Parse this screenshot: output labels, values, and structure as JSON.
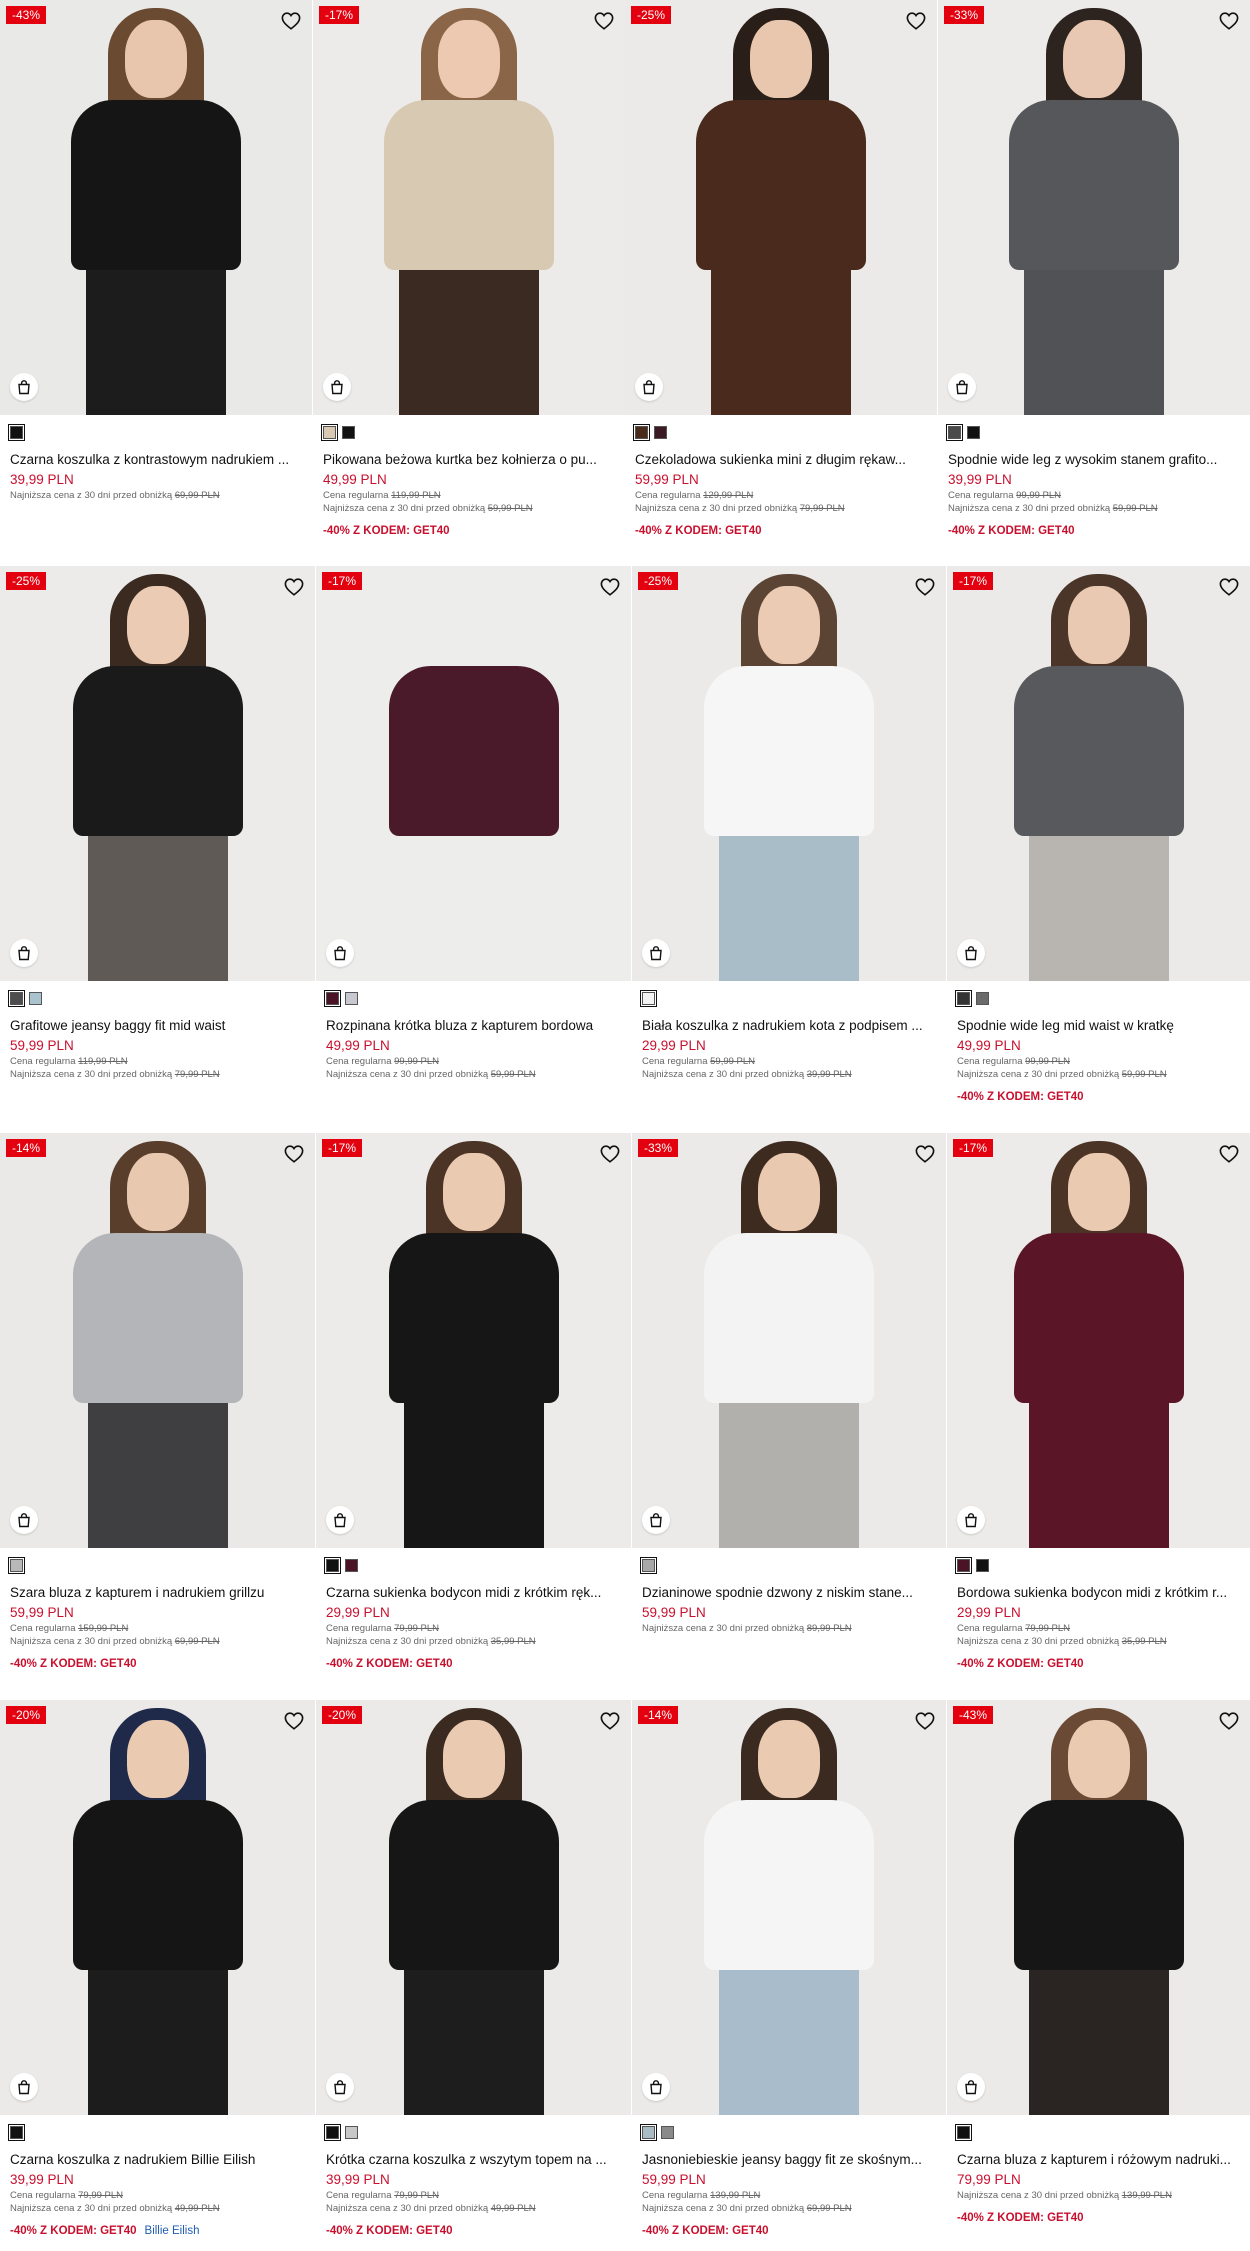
{
  "products": [
    {
      "name": "Czarna koszulka z kontrastowym nadrukiem ...",
      "price": "39,99 PLN",
      "discount": "-43%",
      "regular": "",
      "regular_price": "",
      "lowest": "Najniższa cena z 30 dni przed obniżką",
      "lowest_price": "69,99 PLN",
      "promo": "",
      "artist": "",
      "swatches": [
        "#111111"
      ],
      "look": {
        "bg": "#e9e9e7",
        "top": "#151515",
        "bottom": "#1c1c1c",
        "hair": "#6b4a32",
        "skin": "#e8c6ad"
      }
    },
    {
      "name": "Pikowana beżowa kurtka bez kołnierza o pu...",
      "price": "49,99 PLN",
      "discount": "-17%",
      "regular": "Cena regularna",
      "regular_price": "119,99 PLN",
      "lowest": "Najniższa cena z 30 dni przed obniżką",
      "lowest_price": "59,99 PLN",
      "promo": "-40% Z KODEM: GET40",
      "artist": "",
      "swatches": [
        "#d9c9b2",
        "#111111"
      ],
      "look": {
        "bg": "#ecebe9",
        "top": "#d8c9b3",
        "bottom": "#3a2a22",
        "hair": "#8a6547",
        "skin": "#ecc9b0"
      }
    },
    {
      "name": "Czekoladowa sukienka mini z długim rękaw...",
      "price": "59,99 PLN",
      "discount": "-25%",
      "regular": "Cena regularna",
      "regular_price": "129,99 PLN",
      "lowest": "Najniższa cena z 30 dni przed obniżką",
      "lowest_price": "79,99 PLN",
      "promo": "-40% Z KODEM: GET40",
      "artist": "",
      "swatches": [
        "#4a2c1d",
        "#3b1a24"
      ],
      "look": {
        "bg": "#ebeae8",
        "top": "#4a2a1c",
        "bottom": "#4a2a1c",
        "hair": "#2a1e18",
        "skin": "#e9c7ae"
      }
    },
    {
      "name": "Spodnie wide leg z wysokim stanem grafito...",
      "price": "39,99 PLN",
      "discount": "-33%",
      "regular": "Cena regularna",
      "regular_price": "99,99 PLN",
      "lowest": "Najniższa cena z 30 dni przed obniżką",
      "lowest_price": "59,99 PLN",
      "promo": "-40% Z KODEM: GET40",
      "artist": "",
      "swatches": [
        "#4a4a4a",
        "#111111"
      ],
      "look": {
        "bg": "#ecebea",
        "top": "#55575a",
        "bottom": "#505255",
        "hair": "#2e241f",
        "skin": "#e8c8b2"
      }
    },
    {
      "name": "Grafitowe jeansy baggy fit mid waist",
      "price": "59,99 PLN",
      "discount": "-25%",
      "regular": "Cena regularna",
      "regular_price": "119,99 PLN",
      "lowest": "Najniższa cena z 30 dni przed obniżką",
      "lowest_price": "79,99 PLN",
      "promo": "",
      "artist": "",
      "swatches": [
        "#4d4d4d",
        "#a9c4cf"
      ],
      "look": {
        "bg": "#ecebe9",
        "top": "#1a1a1a",
        "bottom": "#5f5a55",
        "hair": "#3a2a20",
        "skin": "#ebcbb4"
      }
    },
    {
      "name": "Rozpinana krótka bluza z kapturem bordowa",
      "price": "49,99 PLN",
      "discount": "-17%",
      "regular": "Cena regularna",
      "regular_price": "99,99 PLN",
      "lowest": "Najniższa cena z 30 dni przed obniżką",
      "lowest_price": "59,99 PLN",
      "promo": "",
      "artist": "",
      "swatches": [
        "#4a1426",
        "#c8c8d0"
      ],
      "look": {
        "bg": "#ededec",
        "top": "#4b1a2a",
        "bottom": "#ededec",
        "hair": "#ededec",
        "skin": "#ededec"
      }
    },
    {
      "name": "Biała koszulka z nadrukiem kota z podpisem ...",
      "price": "29,99 PLN",
      "discount": "-25%",
      "regular": "Cena regularna",
      "regular_price": "59,99 PLN",
      "lowest": "Najniższa cena z 30 dni przed obniżką",
      "lowest_price": "39,99 PLN",
      "promo": "",
      "artist": "",
      "swatches": [
        "#f4f4f4"
      ],
      "look": {
        "bg": "#ebeae8",
        "top": "#f6f6f6",
        "bottom": "#a9bdc8",
        "hair": "#5c4434",
        "skin": "#ebcbb4"
      }
    },
    {
      "name": "Spodnie wide leg mid waist w kratkę",
      "price": "49,99 PLN",
      "discount": "-17%",
      "regular": "Cena regularna",
      "regular_price": "99,99 PLN",
      "lowest": "Najniższa cena z 30 dni przed obniżką",
      "lowest_price": "59,99 PLN",
      "promo": "-40% Z KODEM: GET40",
      "artist": "",
      "swatches": [
        "#333333",
        "#6b6b6b"
      ],
      "look": {
        "bg": "#ebeae8",
        "top": "#58595c",
        "bottom": "#b8b4b0",
        "hair": "#4a3528",
        "skin": "#e9c9b2"
      }
    },
    {
      "name": "Szara bluza z kapturem i nadrukiem grillzu",
      "price": "59,99 PLN",
      "discount": "-14%",
      "regular": "Cena regularna",
      "regular_price": "159,99 PLN",
      "lowest": "Najniższa cena z 30 dni przed obniżką",
      "lowest_price": "69,99 PLN",
      "promo": "-40% Z KODEM: GET40",
      "artist": "",
      "swatches": [
        "#b8b8b8"
      ],
      "look": {
        "bg": "#eae9e7",
        "top": "#b3b5b8",
        "bottom": "#3f3f42",
        "hair": "#5a3e2c",
        "skin": "#e9c8b0"
      }
    },
    {
      "name": "Czarna sukienka bodycon midi z krótkim ręk...",
      "price": "29,99 PLN",
      "discount": "-17%",
      "regular": "Cena regularna",
      "regular_price": "79,99 PLN",
      "lowest": "Najniższa cena z 30 dni przed obniżką",
      "lowest_price": "35,99 PLN",
      "promo": "-40% Z KODEM: GET40",
      "artist": "",
      "swatches": [
        "#111111",
        "#4a1426"
      ],
      "look": {
        "bg": "#ecebe9",
        "top": "#161616",
        "bottom": "#161616",
        "hair": "#4b3425",
        "skin": "#ebcab2"
      }
    },
    {
      "name": "Dzianinowe spodnie dzwony z niskim stane...",
      "price": "59,99 PLN",
      "discount": "-33%",
      "regular": "",
      "regular_price": "",
      "lowest": "Najniższa cena z 30 dni przed obniżką",
      "lowest_price": "89,99 PLN",
      "promo": "",
      "artist": "",
      "swatches": [
        "#a8a8a8"
      ],
      "look": {
        "bg": "#ebeae8",
        "top": "#f3f3f3",
        "bottom": "#b1b0ad",
        "hair": "#3e2b20",
        "skin": "#eac9b1"
      }
    },
    {
      "name": "Bordowa sukienka bodycon midi z krótkim r...",
      "price": "29,99 PLN",
      "discount": "-17%",
      "regular": "Cena regularna",
      "regular_price": "79,99 PLN",
      "lowest": "Najniższa cena z 30 dni przed obniżką",
      "lowest_price": "35,99 PLN",
      "promo": "-40% Z KODEM: GET40",
      "artist": "",
      "swatches": [
        "#4a1426",
        "#111111"
      ],
      "look": {
        "bg": "#ecebe9",
        "top": "#5a1626",
        "bottom": "#5a1626",
        "hair": "#4b3425",
        "skin": "#ebcab2"
      }
    },
    {
      "name": "Czarna koszulka z nadrukiem Billie Eilish",
      "price": "39,99 PLN",
      "discount": "-20%",
      "regular": "Cena regularna",
      "regular_price": "79,99 PLN",
      "lowest": "Najniższa cena z 30 dni przed obniżką",
      "lowest_price": "49,99 PLN",
      "promo": "-40% Z KODEM: GET40",
      "artist": "Billie Eilish",
      "swatches": [
        "#111111"
      ],
      "look": {
        "bg": "#ebeae8",
        "top": "#151515",
        "bottom": "#1c1c1c",
        "hair": "#1f2a4a",
        "skin": "#ebcab2"
      }
    },
    {
      "name": "Krótka czarna koszulka z wszytym topem na ...",
      "price": "39,99 PLN",
      "discount": "-20%",
      "regular": "Cena regularna",
      "regular_price": "79,99 PLN",
      "lowest": "Najniższa cena z 30 dni przed obniżką",
      "lowest_price": "49,99 PLN",
      "promo": "-40% Z KODEM: GET40",
      "artist": "",
      "swatches": [
        "#111111",
        "#c8c8c8"
      ],
      "look": {
        "bg": "#ebeae8",
        "top": "#161616",
        "bottom": "#1d1d1d",
        "hair": "#3a2a20",
        "skin": "#ebcab2"
      }
    },
    {
      "name": "Jasnoniebieskie jeansy baggy fit ze skośnym...",
      "price": "59,99 PLN",
      "discount": "-14%",
      "regular": "Cena regularna",
      "regular_price": "139,99 PLN",
      "lowest": "Najniższa cena z 30 dni przed obniżką",
      "lowest_price": "69,99 PLN",
      "promo": "-40% Z KODEM: GET40",
      "artist": "",
      "swatches": [
        "#a9bcc4",
        "#8a8a8a"
      ],
      "look": {
        "bg": "#ebeae8",
        "top": "#f5f5f5",
        "bottom": "#a8bccb",
        "hair": "#3a2a20",
        "skin": "#ebcab2"
      }
    },
    {
      "name": "Czarna bluza z kapturem i różowym nadruki...",
      "price": "79,99 PLN",
      "discount": "-43%",
      "regular": "",
      "regular_price": "",
      "lowest": "Najniższa cena z 30 dni przed obniżką",
      "lowest_price": "139,99 PLN",
      "promo": "-40% Z KODEM: GET40",
      "artist": "",
      "swatches": [
        "#111111"
      ],
      "look": {
        "bg": "#ebeae8",
        "top": "#161616",
        "bottom": "#2a2522",
        "hair": "#6a4a34",
        "skin": "#ebcab2"
      }
    }
  ]
}
